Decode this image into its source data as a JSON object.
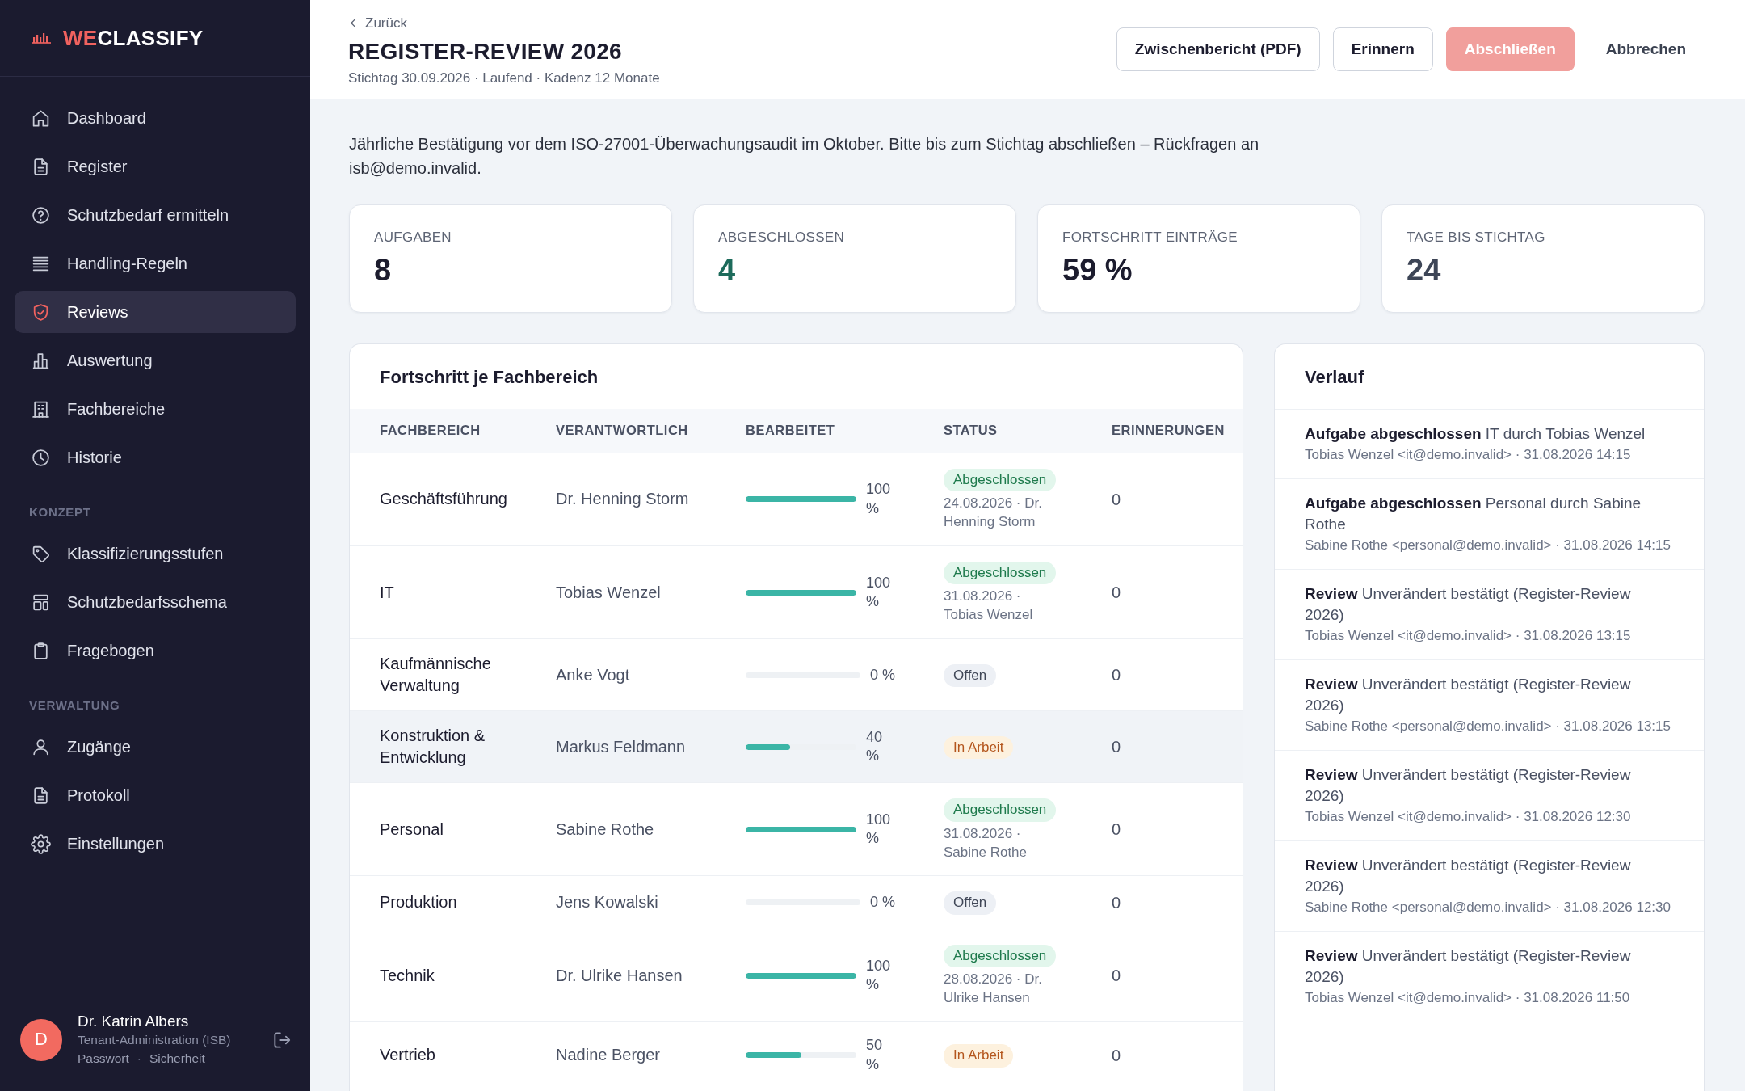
{
  "sidebar": {
    "brand": {
      "accent": "WE",
      "rest": "CLASSIFY"
    },
    "items": [
      {
        "label": "Dashboard",
        "selected": false
      },
      {
        "label": "Register",
        "selected": false
      },
      {
        "label": "Schutzbedarf ermitteln",
        "selected": false
      },
      {
        "label": "Handling-Regeln",
        "selected": false
      },
      {
        "label": "Reviews",
        "selected": true
      },
      {
        "label": "Auswertung",
        "selected": false
      },
      {
        "label": "Fachbereiche",
        "selected": false
      },
      {
        "label": "Historie",
        "selected": false
      }
    ],
    "sections": [
      {
        "title": "KONZEPT",
        "items": [
          {
            "label": "Klassifizierungsstufen",
            "selected": false
          },
          {
            "label": "Schutzbedarfsschema",
            "selected": false
          },
          {
            "label": "Fragebogen",
            "selected": false
          }
        ]
      },
      {
        "title": "VERWALTUNG",
        "items": [
          {
            "label": "Zugänge",
            "selected": false
          },
          {
            "label": "Protokoll",
            "selected": false
          },
          {
            "label": "Einstellungen",
            "selected": false
          }
        ]
      }
    ],
    "user": {
      "initial": "D",
      "name": "Dr. Katrin Albers",
      "role": "Tenant-Administration (ISB)",
      "links": [
        "Passwort",
        "Sicherheit"
      ],
      "link_separator": "·"
    }
  },
  "header": {
    "back": "Zurück",
    "title": "REGISTER-REVIEW 2026",
    "subtitle": "Stichtag 30.09.2026 · Laufend · Kadenz 12 Monate",
    "buttons": [
      {
        "label": "Zwischenbericht (PDF)",
        "kind": "outline",
        "disabled": false
      },
      {
        "label": "Erinnern",
        "kind": "outline",
        "disabled": false
      },
      {
        "label": "Abschließen",
        "kind": "primary",
        "disabled": true
      },
      {
        "label": "Abbrechen",
        "kind": "link",
        "disabled": false
      }
    ]
  },
  "description": "Jährliche Bestätigung vor dem ISO-27001-Überwachungsaudit im Oktober. Bitte bis zum Stichtag abschließen – Rückfragen an isb@demo.invalid.",
  "stats": [
    {
      "label": "AUFGABEN",
      "value": "8",
      "color": "#1c1c2e"
    },
    {
      "label": "ABGESCHLOSSEN",
      "value": "4",
      "color": "#1d6b5b"
    },
    {
      "label": "FORTSCHRITT EINTRÄGE",
      "value": "59 %",
      "color": "#1c1c2e"
    },
    {
      "label": "TAGE BIS STICHTAG",
      "value": "24",
      "color": "#3d4556"
    }
  ],
  "progress": {
    "title": "Fortschritt je Fachbereich",
    "columns": [
      "FACHBEREICH",
      "VERANTWORTLICH",
      "BEARBEITET",
      "STATUS",
      "ERINNERUNGEN"
    ],
    "rows": [
      {
        "area": "Geschäftsführung",
        "owner": "Dr. Henning Storm",
        "level": 1,
        "percent": "100 %",
        "status": {
          "label": "Abgeschlossen",
          "kind": "done"
        },
        "completed": "24.08.2026 · Dr. Henning Storm",
        "reminders": "0",
        "hovered": false
      },
      {
        "area": "IT",
        "owner": "Tobias Wenzel",
        "level": 1,
        "percent": "100 %",
        "status": {
          "label": "Abgeschlossen",
          "kind": "done"
        },
        "completed": "31.08.2026 · Tobias Wenzel",
        "reminders": "0",
        "hovered": false
      },
      {
        "area": "Kaufmännische Verwaltung",
        "owner": "Anke Vogt",
        "level": 0,
        "percent": "0 %",
        "status": {
          "label": "Offen",
          "kind": "open"
        },
        "reminders": "0",
        "hovered": false
      },
      {
        "area": "Konstruktion & Entwicklung",
        "owner": "Markus Feldmann",
        "level": 0.4,
        "percent": "40 %",
        "status": {
          "label": "In Arbeit",
          "kind": "progress"
        },
        "reminders": "0",
        "hovered": true
      },
      {
        "area": "Personal",
        "owner": "Sabine Rothe",
        "level": 1,
        "percent": "100 %",
        "status": {
          "label": "Abgeschlossen",
          "kind": "done"
        },
        "completed": "31.08.2026 · Sabine Rothe",
        "reminders": "0",
        "hovered": false
      },
      {
        "area": "Produktion",
        "owner": "Jens Kowalski",
        "level": 0,
        "percent": "0 %",
        "status": {
          "label": "Offen",
          "kind": "open"
        },
        "reminders": "0",
        "hovered": false
      },
      {
        "area": "Technik",
        "owner": "Dr. Ulrike Hansen",
        "level": 1,
        "percent": "100 %",
        "status": {
          "label": "Abgeschlossen",
          "kind": "done"
        },
        "completed": "28.08.2026 · Dr. Ulrike Hansen",
        "reminders": "0",
        "hovered": false
      },
      {
        "area": "Vertrieb",
        "owner": "Nadine Berger",
        "level": 0.5,
        "percent": "50 %",
        "status": {
          "label": "In Arbeit",
          "kind": "progress"
        },
        "reminders": "0",
        "hovered": false
      }
    ]
  },
  "history": {
    "title": "Verlauf",
    "items": [
      {
        "text": "**Aufgabe abgeschlossen** IT durch Tobias Wenzel",
        "meta": "Tobias Wenzel <it@demo.invalid> · 31.08.2026 14:15"
      },
      {
        "text": "**Aufgabe abgeschlossen** Personal durch Sabine Rothe",
        "meta": "Sabine Rothe <personal@demo.invalid> · 31.08.2026 14:15"
      },
      {
        "text": "**Review** Unverändert bestätigt (Register-Review 2026)",
        "meta": "Tobias Wenzel <it@demo.invalid> · 31.08.2026 13:15"
      },
      {
        "text": "**Review** Unverändert bestätigt (Register-Review 2026)",
        "meta": "Sabine Rothe <personal@demo.invalid> · 31.08.2026 13:15"
      },
      {
        "text": "**Review** Unverändert bestätigt (Register-Review 2026)",
        "meta": "Tobias Wenzel <it@demo.invalid> · 31.08.2026 12:30"
      },
      {
        "text": "**Review** Unverändert bestätigt (Register-Review 2026)",
        "meta": "Sabine Rothe <personal@demo.invalid> · 31.08.2026 12:30"
      },
      {
        "text": "**Review** Unverändert bestätigt (Register-Review 2026)",
        "meta": "Tobias Wenzel <it@demo.invalid> · 31.08.2026 11:50"
      }
    ]
  }
}
